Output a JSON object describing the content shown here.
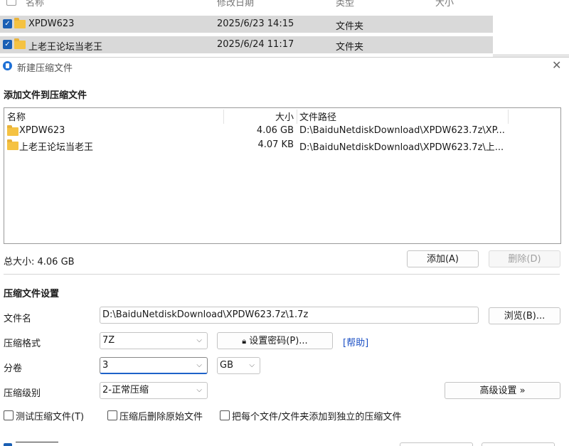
{
  "explorer": {
    "columns": [
      "名称",
      "修改日期",
      "类型",
      "大小"
    ],
    "rows": [
      {
        "name": "XPDW623",
        "date": "2025/6/23 14:15",
        "type": "文件夹"
      },
      {
        "name": "上老王论坛当老王",
        "date": "2025/6/24 11:17",
        "type": "文件夹"
      }
    ]
  },
  "dialog": {
    "title": "新建压缩文件",
    "add_section_title": "添加文件到压缩文件",
    "list": {
      "columns": {
        "name": "名称",
        "size": "大小",
        "path": "文件路径"
      },
      "rows": [
        {
          "name": "XPDW623",
          "size": "4.06 GB",
          "path": "D:\\BaiduNetdiskDownload\\XPDW623.7z\\XP..."
        },
        {
          "name": "上老王论坛当老王",
          "size": "4.07 KB",
          "path": "D:\\BaiduNetdiskDownload\\XPDW623.7z\\上..."
        }
      ]
    },
    "total_size": "总大小: 4.06 GB",
    "add_button": "添加(A)",
    "delete_button": "删除(D)",
    "settings_title": "压缩文件设置",
    "filename_label": "文件名",
    "filename_value": "D:\\BaiduNetdiskDownload\\XPDW623.7z\\1.7z",
    "browse_button": "浏览(B)...",
    "format_label": "压缩格式",
    "format_value": "7Z",
    "password_button": "设置密码(P)...",
    "help_link": "[帮助]",
    "split_label": "分卷",
    "split_value": "3",
    "split_unit": "GB",
    "level_label": "压缩级别",
    "level_value": "2-正常压缩",
    "advanced_button": "高级设置 »",
    "checkboxes": [
      {
        "label": "测试压缩文件(T)",
        "checked": false
      },
      {
        "label": "压缩后删除原始文件",
        "checked": false
      },
      {
        "label": "把每个文件/文件夹添加到独立的压缩文件",
        "checked": false
      }
    ]
  }
}
